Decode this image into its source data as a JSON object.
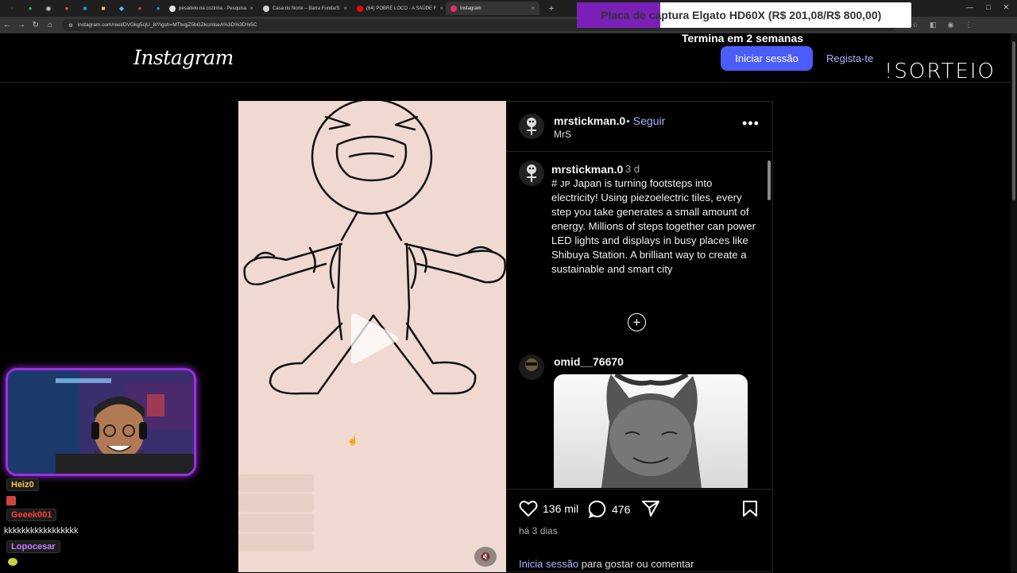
{
  "browser": {
    "tabs": [
      {
        "title": "pesadelo na cozinha - Pesquisa",
        "favicon_color": "#e9e9e9"
      },
      {
        "title": "Casa do Norte – Barra Funda/S",
        "favicon_color": "#cfcfcf"
      },
      {
        "title": "(64) POBRE LOCO - A SAÚDE F",
        "favicon_color": "#ff0000"
      },
      {
        "title": "Instagram",
        "favicon_color": "#e1306c",
        "active": true
      }
    ],
    "url": "instagram.com/reel/DVGkg5cjU_8/?igsh=MTlxqjZ5bGZkcmlseA%3D%3D%5C"
  },
  "overlay": {
    "promo_text": "Placa de captura Elgato HD60X (R$ 201,08/R$ 800,00)",
    "promo_sub": "Termina em 2 semanas",
    "sorteio": "!SORTEIO"
  },
  "header": {
    "logo": "Instagram",
    "login_label": "Iniciar sessão",
    "signup_label": "Regista-te"
  },
  "post": {
    "author": "mrstickman.0",
    "follow_label": "• Seguir",
    "subtitle": "MrS",
    "more": "•••",
    "caption_user": "mrstickman.0",
    "caption_time": "3 d",
    "caption": "# ᴊᴘ Japan is turning footsteps into electricity! Using piezoelectric tiles, every step you take generates a small amount of energy. Millions of steps together can power LED lights and displays in busy places like Shibuya Station. A brilliant way to create a sustainable and smart city",
    "comment_user": "omid__76670",
    "likes": "136 mil",
    "comments": "476",
    "date": "há 3 dias",
    "login_link": "Inicia sessão",
    "login_rest": " para gostar ou comentar"
  },
  "chat": [
    {
      "name": "Heiz0",
      "name_color": "#f5c542",
      "msg": ""
    },
    {
      "name": "Geeek001",
      "name_color": "#ff3b3b",
      "msg": "kkkkkkkkkkkkkkkkk"
    },
    {
      "name": "Lopocesar",
      "name_color": "#c77dff",
      "msg": ""
    }
  ],
  "icons": [
    "heart-icon",
    "comment-icon",
    "share-icon",
    "bookmark-icon",
    "mute-icon",
    "play-icon",
    "add-circle-icon",
    "more-icon"
  ]
}
